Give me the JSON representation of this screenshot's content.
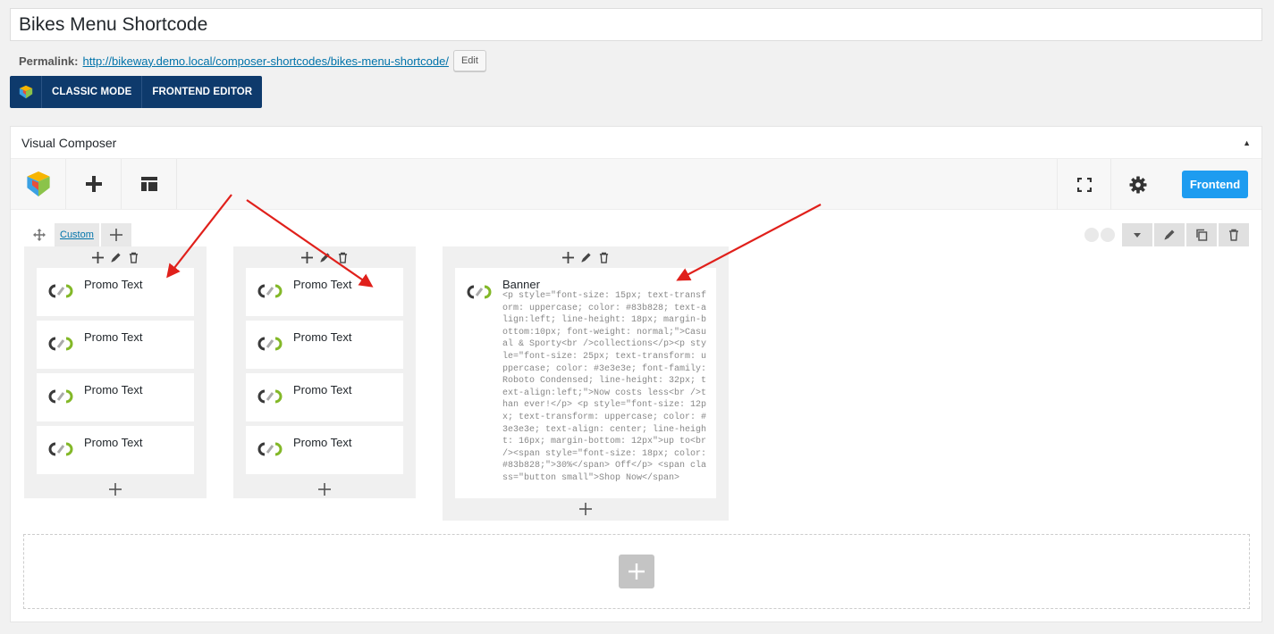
{
  "post": {
    "title": "Bikes Menu Shortcode",
    "permalink_label": "Permalink:",
    "permalink_url": "http://bikeway.demo.local/composer-shortcodes/bikes-menu-shortcode/",
    "edit_label": "Edit"
  },
  "mode_bar": {
    "classic_label": "CLASSIC MODE",
    "frontend_editor_label": "FRONTEND EDITOR"
  },
  "composer": {
    "title": "Visual Composer",
    "frontend_label": "Frontend",
    "row": {
      "layout_label": "Custom"
    },
    "columns": [
      {
        "elements": [
          "Promo Text",
          "Promo Text",
          "Promo Text",
          "Promo Text"
        ]
      },
      {
        "elements": [
          "Promo Text",
          "Promo Text",
          "Promo Text",
          "Promo Text"
        ]
      },
      {
        "banner": {
          "name": "Banner",
          "code": "<p style=\"font-size: 15px; text-transform: uppercase; color: #83b828; text-align:left; line-height: 18px; margin-bottom:10px; font-weight: normal;\">Casual & Sporty<br />collections</p><p style=\"font-size: 25px; text-transform: uppercase; color: #3e3e3e; font-family: Roboto Condensed; line-height: 32px; text-align:left;\">Now costs less<br />than ever!</p>\n<p style=\"font-size: 12px; text-transform: uppercase; color: #3e3e3e; text-align: center; line-height: 16px; margin-bottom: 12px\">up to<br /><span style=\"font-size: 18px; color: #83b828;\">30%</span> Off</p>\n<span class=\"button small\">Shop Now</span>"
        }
      }
    ]
  },
  "colors": {
    "accent_blue": "#1e9cf0",
    "mode_bar_bg": "#0e3a6c",
    "arrow_red": "#e0201b"
  }
}
